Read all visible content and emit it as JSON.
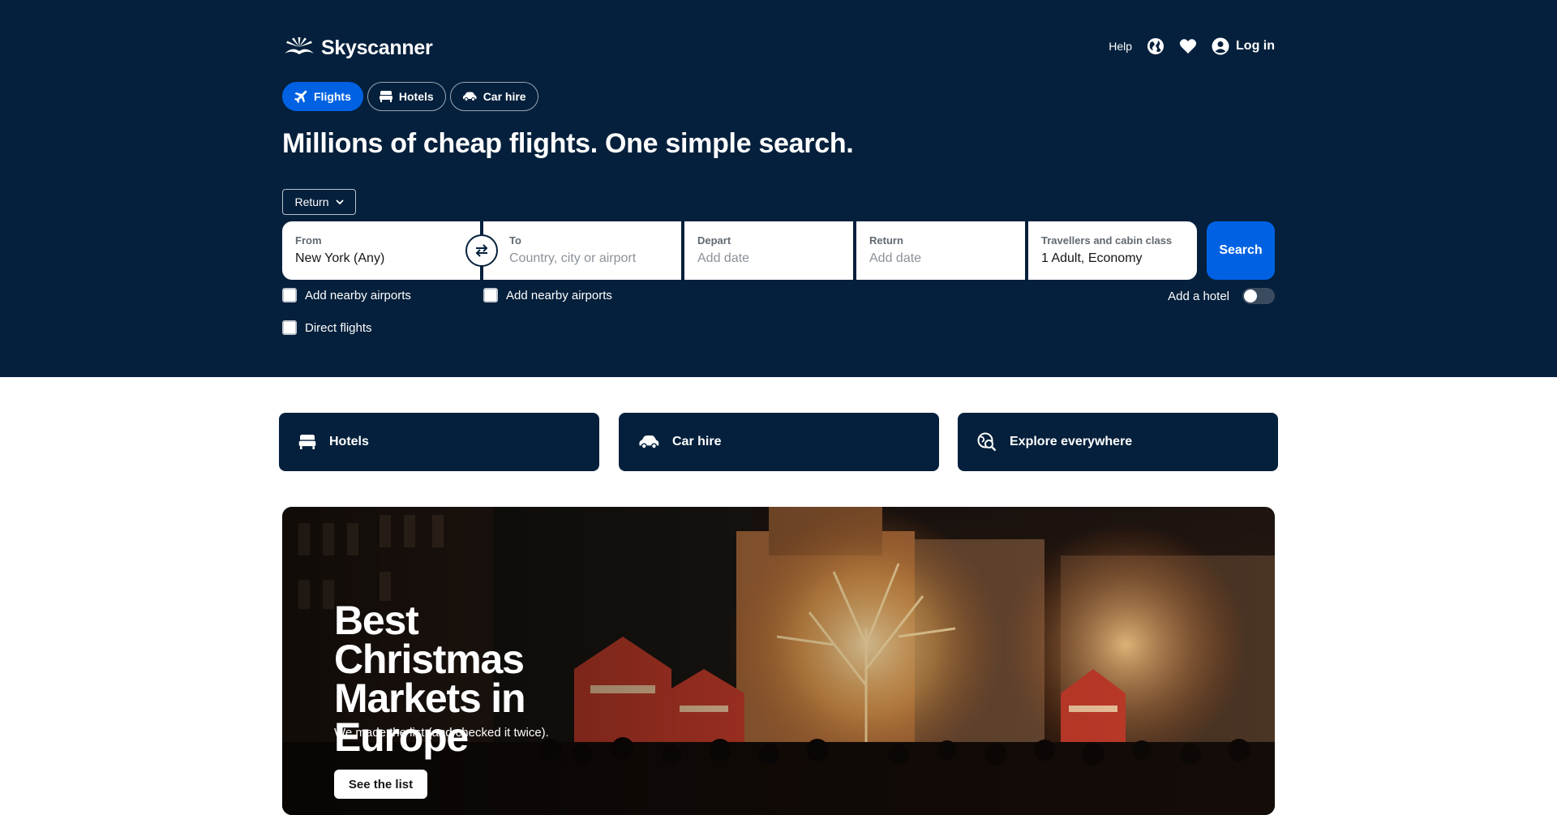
{
  "header": {
    "brand": "Skyscanner",
    "help": "Help",
    "login": "Log in"
  },
  "tabs": [
    {
      "label": "Flights",
      "icon": "plane-icon",
      "active": true
    },
    {
      "label": "Hotels",
      "icon": "bed-icon",
      "active": false
    },
    {
      "label": "Car hire",
      "icon": "car-icon",
      "active": false
    }
  ],
  "headline": "Millions of cheap flights. One simple search.",
  "search": {
    "trip_type": "Return",
    "from": {
      "label": "From",
      "value": "New York (Any)"
    },
    "to": {
      "label": "To",
      "placeholder": "Country, city or airport"
    },
    "depart": {
      "label": "Depart",
      "placeholder": "Add date"
    },
    "return": {
      "label": "Return",
      "placeholder": "Add date"
    },
    "travellers": {
      "label": "Travellers and cabin class",
      "value": "1 Adult, Economy"
    },
    "button": "Search"
  },
  "options": {
    "nearby_from": "Add nearby airports",
    "nearby_to": "Add nearby airports",
    "direct": "Direct flights",
    "add_hotel": "Add a hotel"
  },
  "quick_links": [
    {
      "label": "Hotels",
      "icon": "bed-icon"
    },
    {
      "label": "Car hire",
      "icon": "car-icon"
    },
    {
      "label": "Explore everywhere",
      "icon": "globe-search-icon"
    }
  ],
  "promo": {
    "title": "Best Christmas Markets in Europe",
    "subtitle": "We made the list (and checked it twice).",
    "button": "See the list"
  },
  "colors": {
    "navy": "#05203c",
    "blue": "#0062e3"
  }
}
